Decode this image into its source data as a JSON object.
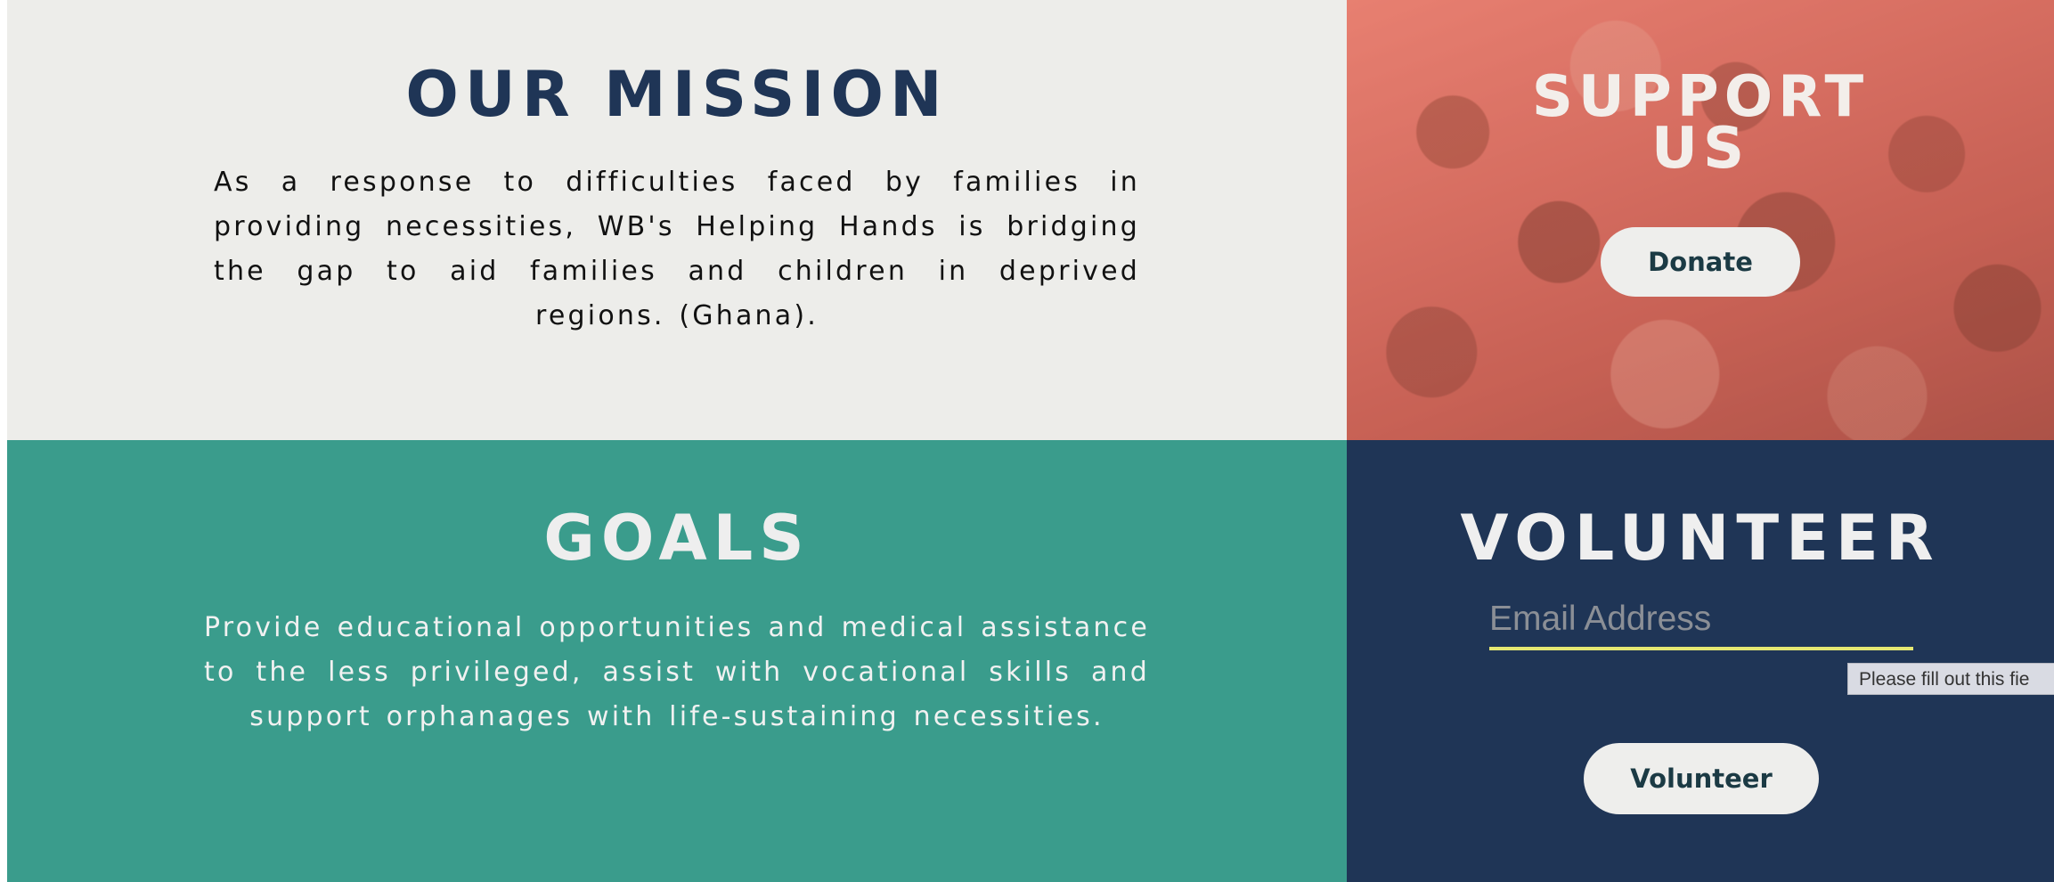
{
  "mission": {
    "title": "OUR MISSION",
    "text": "As a response to difficulties faced by families in providing necessities, WB's Helping Hands is bridging the gap to aid families and children in deprived regions. (Ghana)."
  },
  "goals": {
    "title": "GOALS",
    "text": "Provide educational opportunities and medical assistance to the less privileged, assist with vocational skills and support orphanages with life-sustaining necessities."
  },
  "support": {
    "title": "SUPPORT US",
    "donate_label": "Donate"
  },
  "volunteer": {
    "title": "VOLUNTEER",
    "email_placeholder": "Email Address",
    "validation_message": "Please fill out this fie",
    "button_label": "Volunteer"
  },
  "colors": {
    "navy": "#1f3556",
    "teal": "#3a9c8c",
    "light_bg": "#ededea",
    "input_underline": "#e6e872"
  }
}
